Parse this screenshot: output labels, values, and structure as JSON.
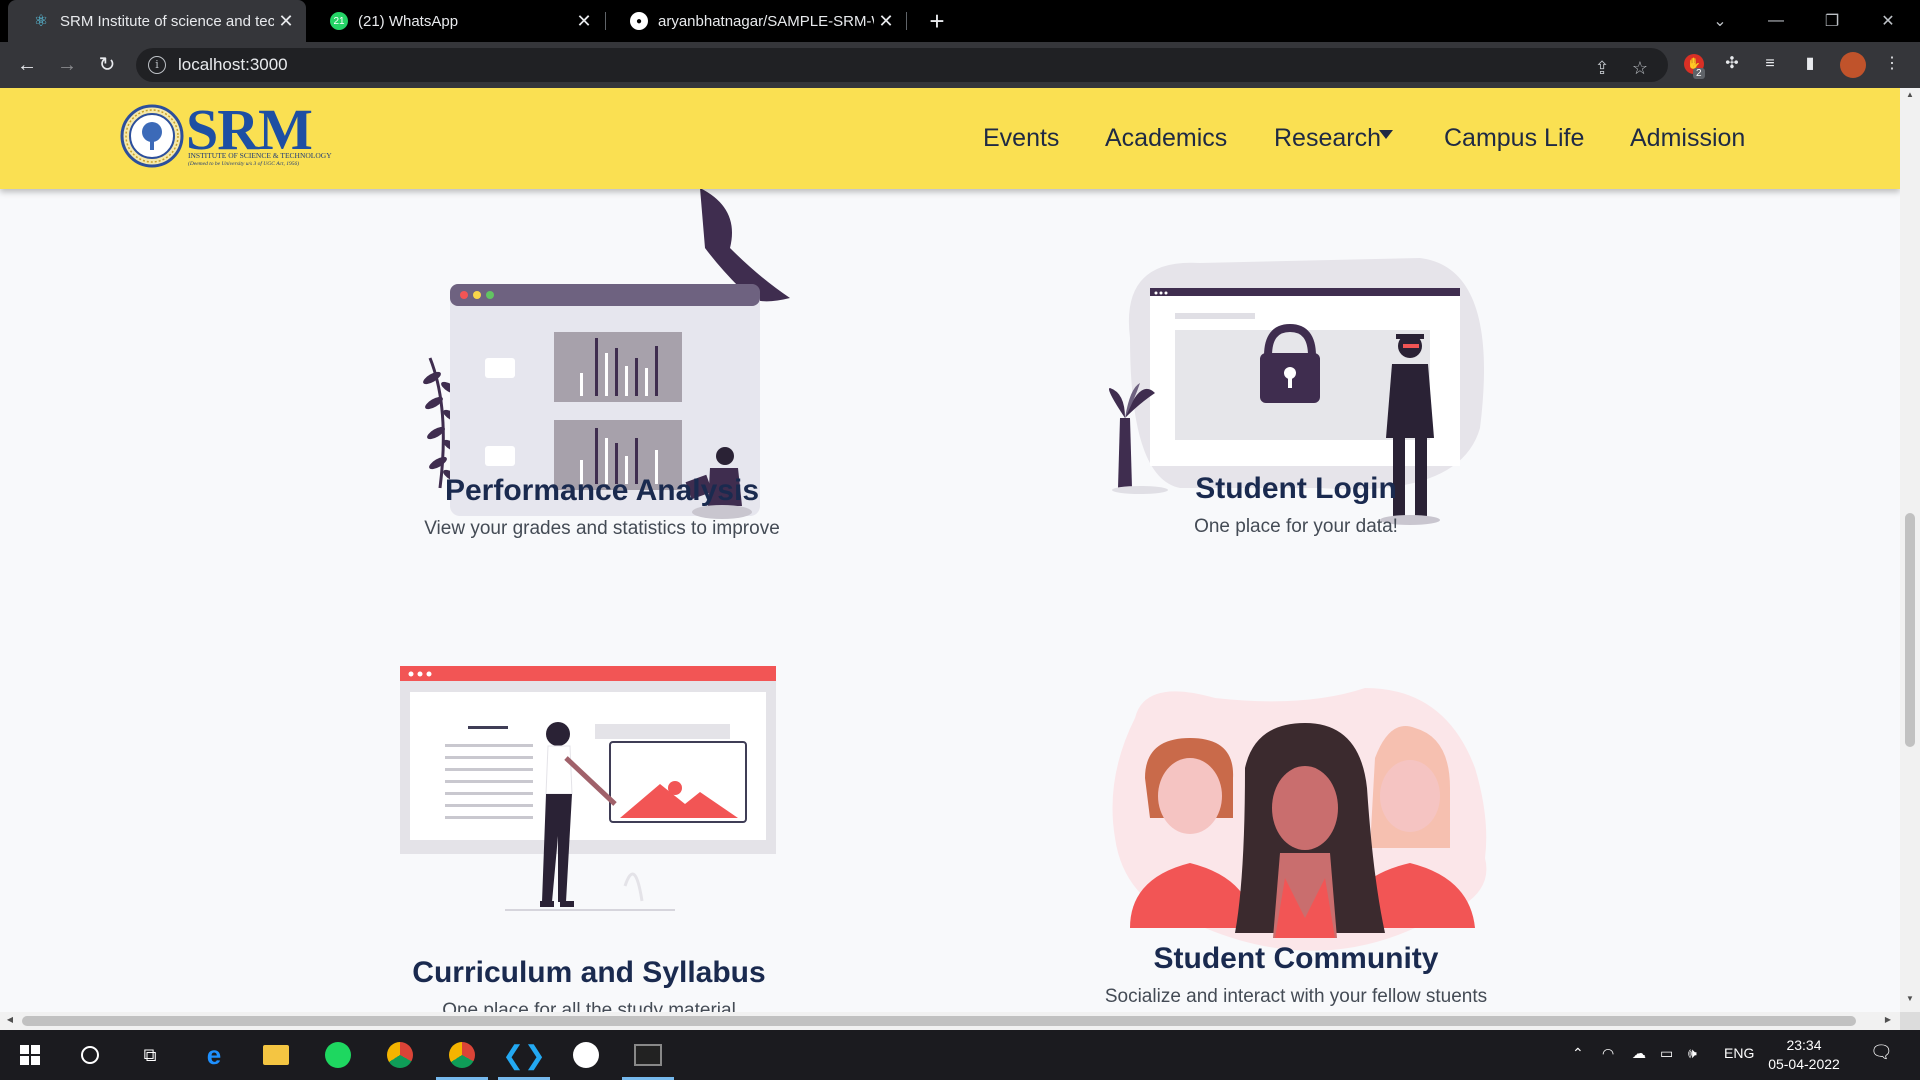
{
  "browser": {
    "tabs": [
      {
        "title": "SRM Institute of science and tech",
        "icon": "react-icon",
        "active": true
      },
      {
        "title": "(21) WhatsApp",
        "icon": "whatsapp-icon",
        "badge": "21",
        "active": false
      },
      {
        "title": "aryanbhatnagar/SAMPLE-SRM-W",
        "icon": "github-icon",
        "active": false
      }
    ],
    "url": "localhost:3000",
    "extension_badge": "2"
  },
  "site": {
    "nav": {
      "logo_text": "SRM",
      "logo_sub": "INSTITUTE OF SCIENCE & TECHNOLOGY",
      "logo_sub2": "(Deemed to be University u/s 3 of UGC Act, 1956)",
      "items": [
        "Events",
        "Academics",
        "Research",
        "Campus Life",
        "Admission"
      ]
    },
    "features": [
      {
        "title": "Performance Analysis",
        "subtitle": "View your grades and statistics to improve"
      },
      {
        "title": "Student Login",
        "subtitle": "One place for your data!"
      },
      {
        "title": "Curriculum and Syllabus",
        "subtitle": "One place for all the study material"
      },
      {
        "title": "Student Community",
        "subtitle": "Socialize and interact with your fellow stuents"
      }
    ]
  },
  "taskbar": {
    "lang": "ENG",
    "time": "23:34",
    "date": "05-04-2022"
  },
  "colors": {
    "navbar": "#fae052",
    "heading": "#1a2a4f",
    "accent_red": "#f25555",
    "accent_purple": "#3f2d4f"
  }
}
